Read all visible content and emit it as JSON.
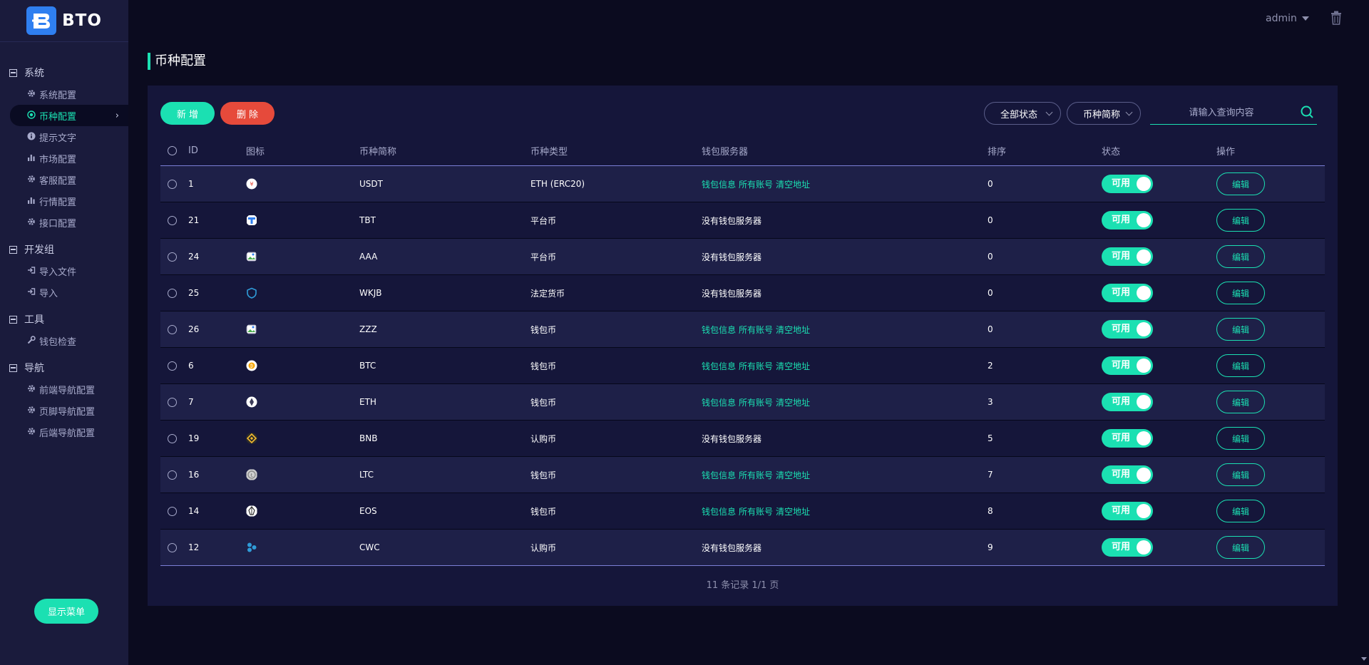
{
  "brand": {
    "name": "BTO"
  },
  "header": {
    "user": "admin"
  },
  "sidebar": {
    "groups": [
      {
        "label": "系统",
        "items": [
          {
            "label": "系统配置",
            "icon": "gear-icon"
          },
          {
            "label": "币种配置",
            "icon": "target-icon",
            "active": true
          },
          {
            "label": "提示文字",
            "icon": "info-icon"
          },
          {
            "label": "市场配置",
            "icon": "bar-chart-icon"
          },
          {
            "label": "客服配置",
            "icon": "gear-icon"
          },
          {
            "label": "行情配置",
            "icon": "bar-chart-icon"
          },
          {
            "label": "接口配置",
            "icon": "gear-icon"
          }
        ]
      },
      {
        "label": "开发组",
        "items": [
          {
            "label": "导入文件",
            "icon": "sign-in-icon"
          },
          {
            "label": "导入",
            "icon": "sign-in-icon"
          }
        ]
      },
      {
        "label": "工具",
        "items": [
          {
            "label": "钱包检查",
            "icon": "wrench-icon"
          }
        ]
      },
      {
        "label": "导航",
        "items": [
          {
            "label": "前端导航配置",
            "icon": "gear-icon"
          },
          {
            "label": "页脚导航配置",
            "icon": "gear-icon"
          },
          {
            "label": "后端导航配置",
            "icon": "gear-icon"
          }
        ]
      }
    ],
    "show_menu_label": "显示菜单"
  },
  "page": {
    "title": "币种配置"
  },
  "toolbar": {
    "add_label": "新 增",
    "delete_label": "删 除",
    "status_filter": "全部状态",
    "name_filter": "币种简称",
    "search_placeholder": "请输入查询内容"
  },
  "table": {
    "headers": [
      "ID",
      "图标",
      "币种简称",
      "币种类型",
      "钱包服务器",
      "排序",
      "状态",
      "操作"
    ],
    "wallet_links": [
      "钱包信息",
      "所有账号",
      "清空地址"
    ],
    "no_server_text": "没有钱包服务器",
    "status_label": "可用",
    "edit_label": "编辑",
    "rows": [
      {
        "id": "1",
        "name": "USDT",
        "type": "ETH (ERC20)",
        "has_server": true,
        "sort": "0",
        "icon": "usdt-icon"
      },
      {
        "id": "21",
        "name": "TBT",
        "type": "平台币",
        "has_server": false,
        "sort": "0",
        "icon": "tbt-icon"
      },
      {
        "id": "24",
        "name": "AAA",
        "type": "平台币",
        "has_server": false,
        "sort": "0",
        "icon": "broken-image-icon"
      },
      {
        "id": "25",
        "name": "WKJB",
        "type": "法定货币",
        "has_server": false,
        "sort": "0",
        "icon": "shield-icon"
      },
      {
        "id": "26",
        "name": "ZZZ",
        "type": "钱包币",
        "has_server": true,
        "sort": "0",
        "icon": "broken-image-icon"
      },
      {
        "id": "6",
        "name": "BTC",
        "type": "钱包币",
        "has_server": true,
        "sort": "2",
        "icon": "btc-icon"
      },
      {
        "id": "7",
        "name": "ETH",
        "type": "钱包币",
        "has_server": true,
        "sort": "3",
        "icon": "eth-icon"
      },
      {
        "id": "19",
        "name": "BNB",
        "type": "认购币",
        "has_server": false,
        "sort": "5",
        "icon": "bnb-icon"
      },
      {
        "id": "16",
        "name": "LTC",
        "type": "钱包币",
        "has_server": true,
        "sort": "7",
        "icon": "ltc-icon"
      },
      {
        "id": "14",
        "name": "EOS",
        "type": "钱包币",
        "has_server": true,
        "sort": "8",
        "icon": "eos-icon"
      },
      {
        "id": "12",
        "name": "CWC",
        "type": "认购币",
        "has_server": false,
        "sort": "9",
        "icon": "cwc-icon"
      }
    ]
  },
  "pagination": {
    "summary": "11 条记录 1/1 页"
  },
  "colors": {
    "accent": "#1be0b2",
    "danger": "#e64a3b",
    "sidebar_bg": "#1a1b3c",
    "page_bg": "#0b0b1f",
    "panel_bg": "#15163a"
  }
}
